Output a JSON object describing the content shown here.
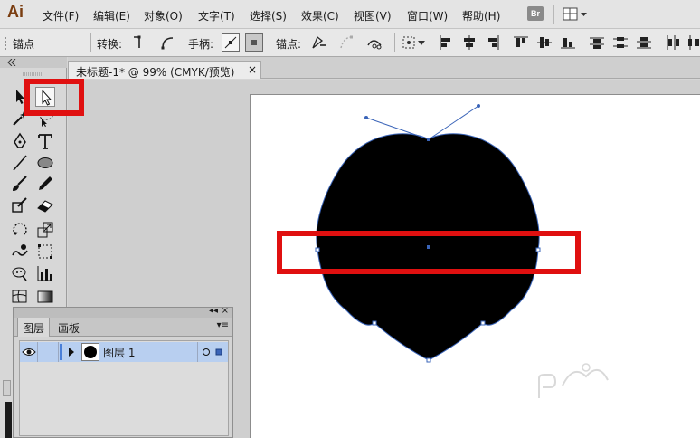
{
  "app": {
    "logo": "Ai",
    "menu": [
      "文件(F)",
      "编辑(E)",
      "对象(O)",
      "文字(T)",
      "选择(S)",
      "效果(C)",
      "视图(V)",
      "窗口(W)",
      "帮助(H)"
    ],
    "bridge_label": "Br"
  },
  "controlbar": {
    "mode_label": "锚点",
    "convert_label": "转换:",
    "handles_label": "手柄:",
    "anchors_label": "锚点:"
  },
  "document": {
    "tab_title": "未标题-1* @ 99% (CMYK/预览)",
    "close_glyph": "×"
  },
  "layers_panel": {
    "collapse_glyph": "◂◂",
    "close_glyph": "×",
    "menu_glyph": "▾≡",
    "tabs": [
      "图层",
      "画板"
    ],
    "layers": [
      {
        "name": "图层 1",
        "visible": true,
        "selected": true
      }
    ]
  },
  "colors": {
    "highlight": "#e01010",
    "path": "#3a64b8",
    "shape_fill": "#000000",
    "layer_row": "#b8cff0"
  },
  "icons": {
    "tools": [
      "selection-tool-icon",
      "direct-selection-tool-icon",
      "magic-wand-icon",
      "lasso-icon",
      "pen-tool-icon",
      "type-tool-icon",
      "line-segment-icon",
      "ellipse-tool-icon",
      "paintbrush-icon",
      "pencil-icon",
      "blob-brush-icon",
      "eraser-icon",
      "rotate-icon",
      "scale-icon",
      "warp-icon",
      "free-transform-icon",
      "symbol-sprayer-icon",
      "column-graph-icon",
      "mesh-icon",
      "gradient-icon"
    ]
  }
}
